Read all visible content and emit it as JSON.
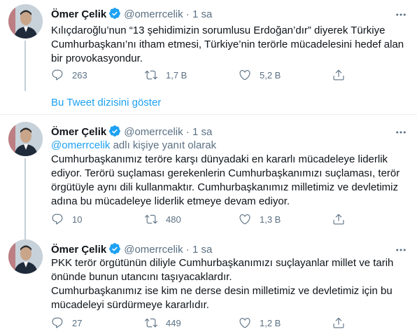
{
  "tweets": [
    {
      "name": "Ömer Çelik",
      "handle": "@omerrcelik",
      "dot": "·",
      "time": "1 sa",
      "text": [
        "Kılıçdaroğlu’nun “13 şehidimizin sorumlusu Erdoğan’dır” diyerek Türkiye Cumhurbaşkanı’nı itham etmesi, Türkiye’nin terörle mücadelesini hedef alan bir provokasyondur."
      ],
      "replies": "263",
      "retweets": "1,7 B",
      "likes": "5,2 B"
    },
    {
      "name": "Ömer Çelik",
      "handle": "@omerrcelik",
      "dot": "·",
      "time": "1 sa",
      "reply_mention": "@omerrcelik",
      "reply_suffix": " adlı kişiye yanıt olarak",
      "text": [
        "Cumhurbaşkanımız teröre karşı dünyadaki en kararlı mücadeleye liderlik ediyor. Terörü suçlaması gerekenlerin Cumhurbaşkanımızı suçlaması, terör örgütüyle aynı dili kullanmaktır. Cumhurbaşkanımız milletimiz ve devletimiz adına bu mücadeleye liderlik etmeye devam ediyor."
      ],
      "replies": "10",
      "retweets": "480",
      "likes": "1,3 B"
    },
    {
      "name": "Ömer Çelik",
      "handle": "@omerrcelik",
      "dot": "·",
      "time": "1 sa",
      "text": [
        "PKK terör örgütünün diliyle Cumhurbaşkanımızı suçlayanlar millet ve tarih önünde bunun utancını taşıyacaklardır.",
        "Cumhurbaşkanımız ise kim ne derse desin milletimiz ve devletimiz için bu mücadeleyi sürdürmeye kararlıdır."
      ],
      "replies": "27",
      "retweets": "449",
      "likes": "1,2 B"
    }
  ],
  "show_thread": "Bu Tweet dizisini göster",
  "icons": {
    "reply": "reply-icon",
    "retweet": "retweet-icon",
    "like": "heart-icon",
    "share": "share-icon",
    "more": "more-icon",
    "verified": "verified-badge-icon"
  },
  "colors": {
    "accent": "#1da1f2",
    "secondary_text": "#5b7083",
    "divider": "#ebeef0"
  }
}
